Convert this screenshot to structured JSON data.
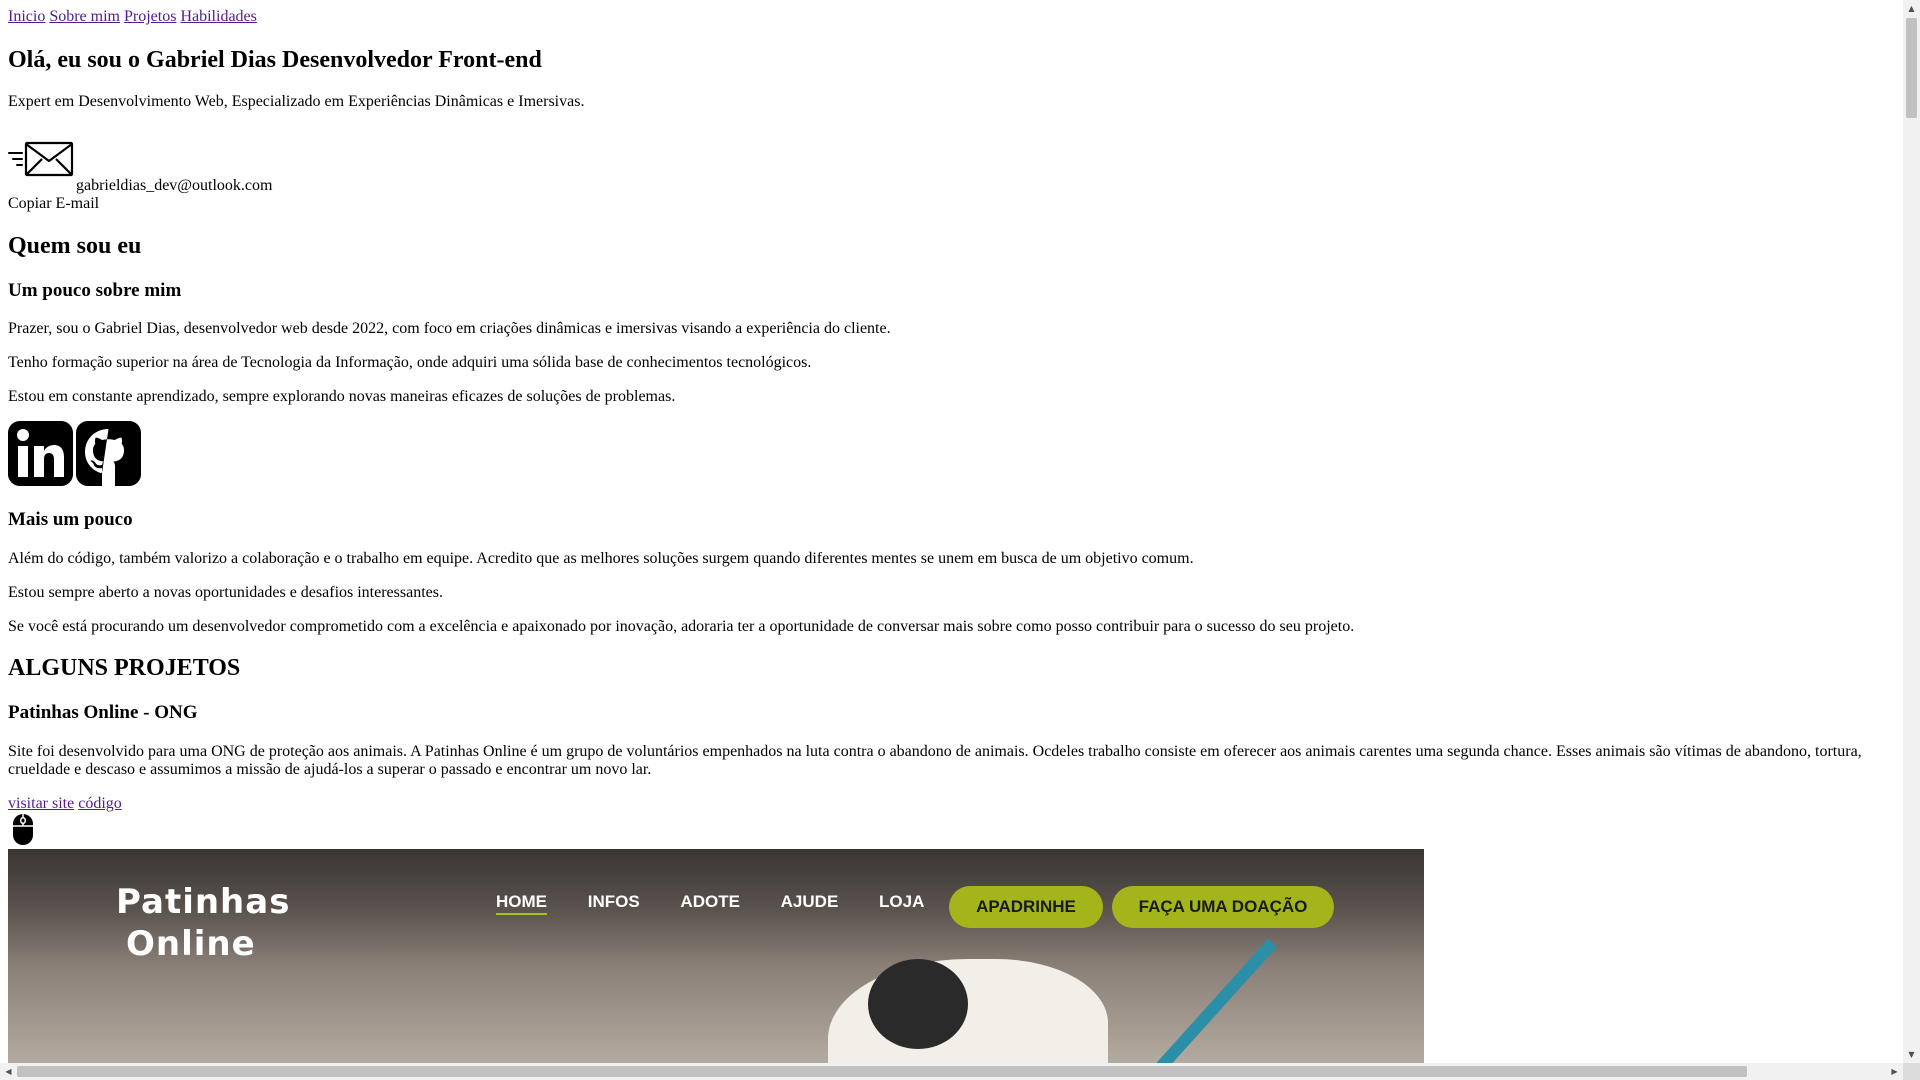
{
  "nav": {
    "links": [
      "Inicio",
      "Sobre mim",
      "Projetos",
      "Habilidades"
    ]
  },
  "hero": {
    "title": "Olá, eu sou o Gabriel Dias Desenvolvedor Front-end",
    "subtitle": "Expert em Desenvolvimento Web, Especializado em Experiências Dinâmicas e Imersivas.",
    "email": "gabrieldias_dev@outlook.com",
    "copy_label": "Copiar E-mail",
    "email_icon": "mail-icon"
  },
  "about": {
    "heading": "Quem sou eu",
    "sub1": "Um pouco sobre mim",
    "p1": "Prazer, sou o Gabriel Dias, desenvolvedor web desde 2022, com foco em criações dinâmicas e imersivas visando a experiência do cliente.",
    "p2": "Tenho formação superior na área de Tecnologia da Informação, onde adquiri uma sólida base de conhecimentos tecnológicos.",
    "p3": "Estou em constante aprendizado, sempre explorando novas maneiras eficazes de soluções de problemas.",
    "social_icons": [
      "linkedin-icon",
      "github-icon"
    ],
    "sub2": "Mais um pouco",
    "p4": "Além do código, também valorizo a colaboração e o trabalho em equipe. Acredito que as melhores soluções surgem quando diferentes mentes se unem em busca de um objetivo comum.",
    "p5": "Estou sempre aberto a novas oportunidades e desafios interessantes.",
    "p6": "Se você está procurando um desenvolvedor comprometido com a excelência e apaixonado por inovação, adoraria ter a oportunidade de conversar mais sobre como posso contribuir para o sucesso do seu projeto."
  },
  "projects": {
    "heading": "ALGUNS PROJETOS",
    "project1": {
      "title": "Patinhas Online - ONG",
      "description": "Site foi desenvolvido para uma ONG de proteção aos animais. A Patinhas Online é um grupo de voluntários empenhados na luta contra o abandono de animais. Ocdeles trabalho consiste em oferecer aos animais carentes uma segunda chance. Esses animais são vítimas de abandono, tortura, crueldade e descaso e assumimos a missão de ajudá-los a superar o passado e encontrar um novo lar.",
      "visit_label": "visitar site",
      "code_label": "código",
      "mouse_icon": "mouse-icon",
      "screenshot": {
        "logo_line1": "Patinhas",
        "logo_line2": "Online",
        "menu": [
          "HOME",
          "INFOS",
          "ADOTE",
          "AJUDE",
          "LOJA"
        ],
        "btn_apadrinhe": "APADRINHE",
        "btn_doacao": "FAÇA UMA DOAÇÃO",
        "accent_color": "#a3b51a"
      }
    }
  },
  "colors": {
    "link": "#551a8b",
    "text": "#000000",
    "background": "#ffffff"
  }
}
